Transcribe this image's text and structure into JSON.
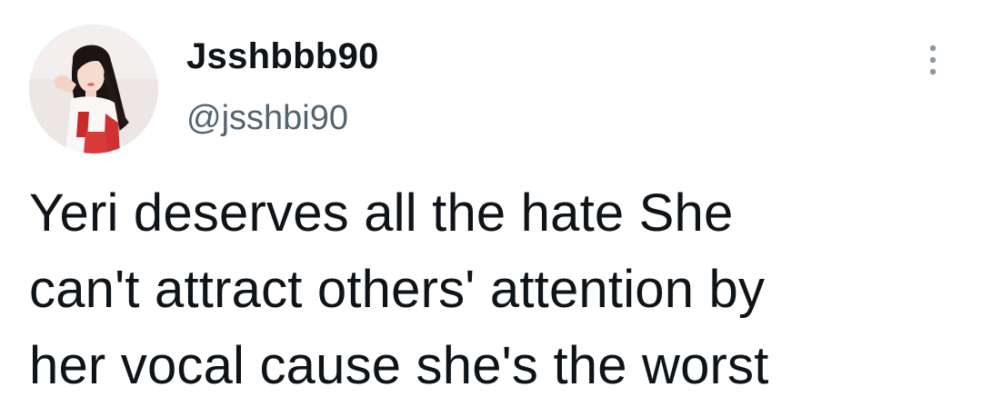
{
  "author": {
    "display_name": "Jsshbbb90",
    "handle": "@jsshbi90",
    "avatar_icon": "profile-photo"
  },
  "actions": {
    "more_icon": "more-vertical-icon"
  },
  "tweet": {
    "lines": [
      "Yeri deserves all the hate She",
      "can't attract others' attention by",
      "her vocal cause she's the worst"
    ]
  },
  "colors": {
    "text": "#0f1419",
    "secondary": "#536471",
    "more_dots": "#8b98a5",
    "background": "#ffffff"
  }
}
